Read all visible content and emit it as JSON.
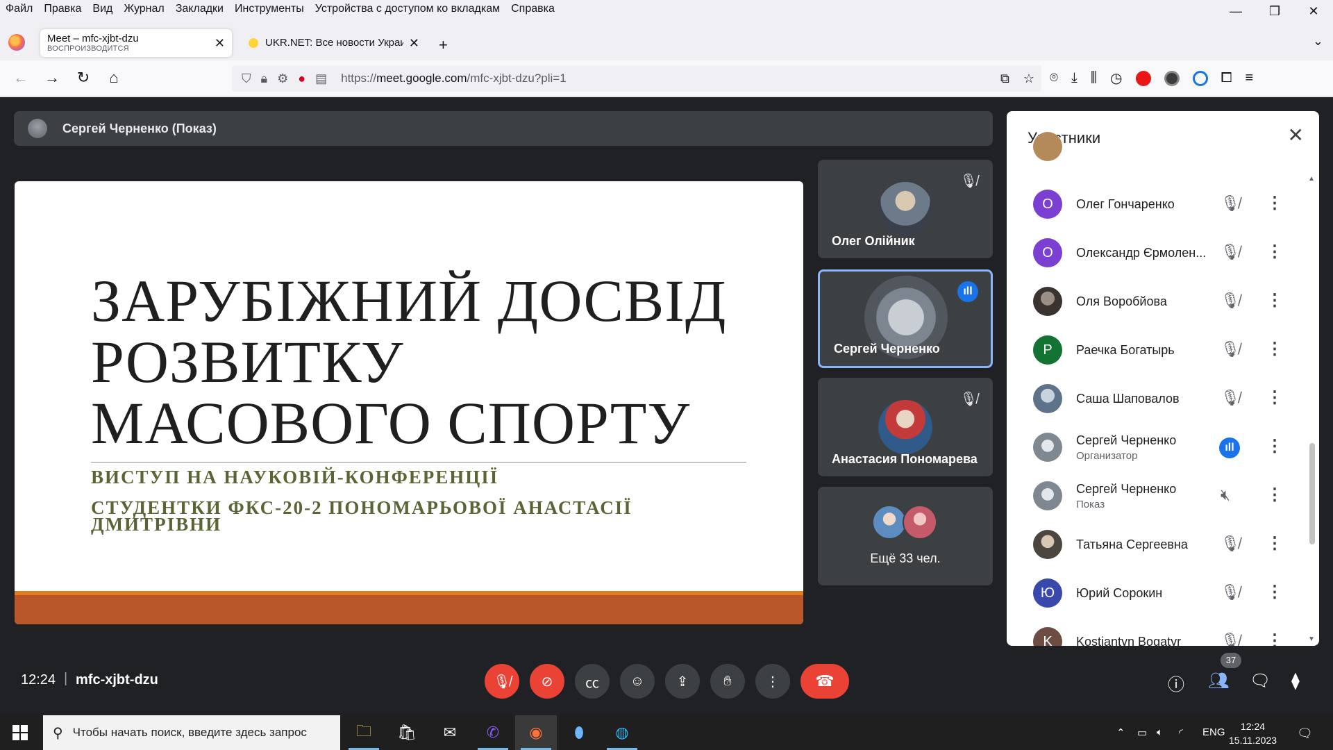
{
  "menubar": {
    "items": [
      "Файл",
      "Правка",
      "Вид",
      "Журнал",
      "Закладки",
      "Инструменты",
      "Устройства с доступом ко вкладкам",
      "Справка"
    ]
  },
  "tabs": [
    {
      "title": "Meet – mfc-xjbt-dzu",
      "subtitle": "ВОСПРОИЗВОДИТСЯ",
      "active": true
    },
    {
      "title": "UKR.NET: Все новости Украины",
      "active": false
    }
  ],
  "urlbar": {
    "url_prefix": "https://",
    "url_host": "meet.google.com",
    "url_path": "/mfc-xjbt-dzu?pli=1"
  },
  "meet": {
    "presenter_label": "Сергей Черненко (Показ)",
    "slide": {
      "title_lines": [
        "ЗАРУБІЖНИЙ ДОСВІД",
        "РОЗВИТКУ",
        "МАСОВОГО СПОРТУ"
      ],
      "subtitle_1": "ВИСТУП НА НАУКОВІЙ-КОНФЕРЕНЦІЇ",
      "subtitle_2a": "СТУДЕНТКИ ФКС-20-2 ПОНОМАРЬОВОЇ АНАСТАСІЇ",
      "subtitle_2b": "ДМИТРІВНИ"
    },
    "tiles": [
      {
        "name": "Олег Олійник",
        "muted": true
      },
      {
        "name": "Сергей Черненко",
        "speaking": true
      },
      {
        "name": "Анастасия Пономарева",
        "muted": true
      },
      {
        "more_label": "Ещё 33 чел."
      }
    ],
    "participants_panel": {
      "title": "Участники",
      "rows": [
        {
          "name": "Олег Гончаренко",
          "initial": "О",
          "color": "#7b3fd1"
        },
        {
          "name": "Олександр Єрмолен...",
          "initial": "О",
          "color": "#7b3fd1"
        },
        {
          "name": "Оля Воробйова",
          "initial": "",
          "color": "#4a4a4a"
        },
        {
          "name": "Раечка Богатырь",
          "initial": "Р",
          "color": "#137333"
        },
        {
          "name": "Саша Шаповалов",
          "initial": "",
          "color": "#6b7b8c"
        },
        {
          "name": "Сергей Черненко",
          "role": "Организатор",
          "initial": "",
          "color": "#8a8f95",
          "speaking": true
        },
        {
          "name": "Сергей Черненко",
          "role": "Показ",
          "initial": "",
          "color": "#8a8f95"
        },
        {
          "name": "Татьяна Сергеевна",
          "initial": "",
          "color": "#5f5a50"
        },
        {
          "name": "Юрий Сорокин",
          "initial": "Ю",
          "color": "#3949ab"
        },
        {
          "name": "Kostiantyn Bogatyr",
          "initial": "K",
          "color": "#6d4c41"
        }
      ]
    },
    "controls": {
      "time": "12:24",
      "meeting_code": "mfc-xjbt-dzu",
      "participants_count": "37"
    }
  },
  "taskbar": {
    "search_placeholder": "Чтобы начать поиск, введите здесь запрос",
    "lang": "ENG",
    "time": "12:24",
    "date": "15.11.2023"
  },
  "colors": {
    "meet_bg": "#202124",
    "end_call": "#ea4335",
    "accent": "#1a73e8",
    "slide_bar": "#b9572a"
  }
}
